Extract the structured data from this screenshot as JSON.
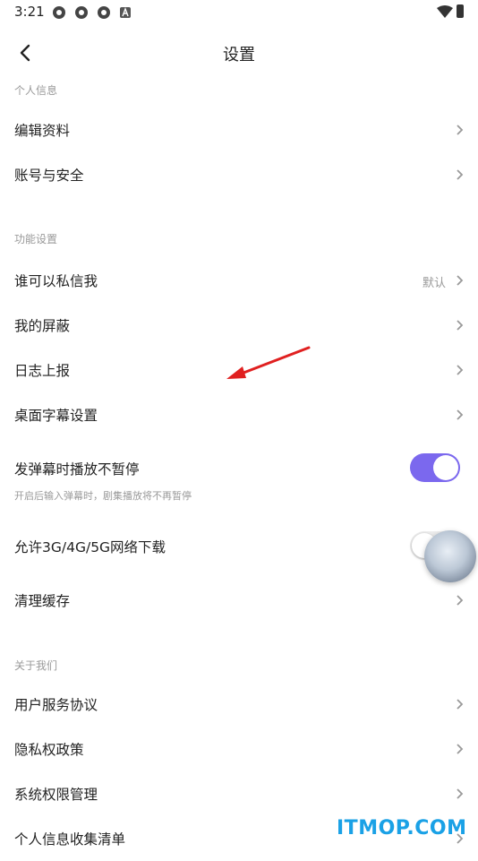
{
  "status_bar": {
    "time": "3:21"
  },
  "header": {
    "title": "设置"
  },
  "sections": {
    "personal": {
      "label": "个人信息"
    },
    "function": {
      "label": "功能设置"
    },
    "about": {
      "label": "关于我们"
    }
  },
  "items": {
    "edit_profile": "编辑资料",
    "account_security": "账号与安全",
    "who_can_message": "谁可以私信我",
    "who_can_message_value": "默认",
    "my_blocked": "我的屏蔽",
    "logs_report": "日志上报",
    "desktop_subtitle": "桌面字幕设置",
    "danmaku_no_pause": "发弹幕时播放不暂停",
    "danmaku_no_pause_desc": "开启后输入弹幕时，剧集播放将不再暂停",
    "allow_mobile_download": "允许3G/4G/5G网络下载",
    "clear_cache": "清理缓存",
    "user_agreement": "用户服务协议",
    "privacy_policy": "隐私权政策",
    "system_permissions": "系统权限管理",
    "personal_info_list": "个人信息收集清单"
  },
  "toggles": {
    "danmaku_no_pause": true,
    "allow_mobile_download": false
  },
  "watermark": "ITMOP.COM",
  "colors": {
    "accent": "#7b68ee",
    "annotation_arrow": "#e02020",
    "watermark": "#1aa1e6"
  }
}
